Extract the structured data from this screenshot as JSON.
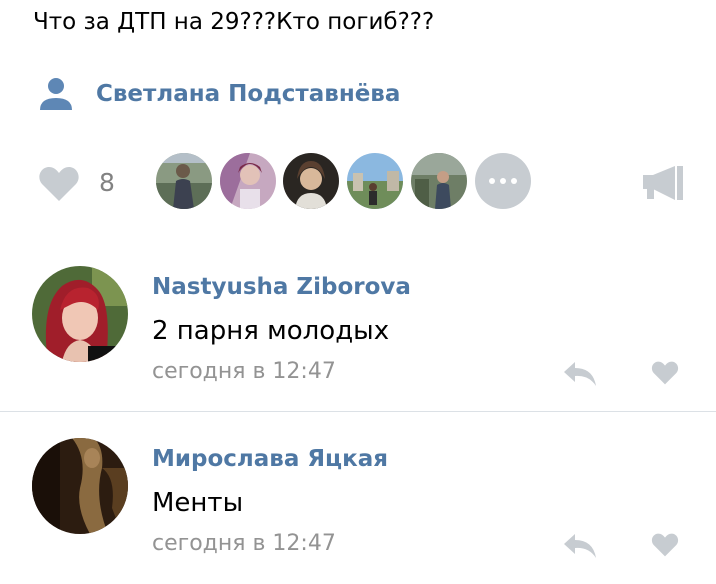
{
  "post": {
    "text": "Что за ДТП на 29???Кто погиб???",
    "author": "Светлана Подставнёва",
    "author_icon": "user-icon"
  },
  "likes": {
    "count": "8",
    "icon": "heart-icon",
    "share_icon": "megaphone-icon",
    "more_icon": "ellipsis-icon"
  },
  "comments": [
    {
      "author": "Nastyusha Ziborova",
      "text": "2 парня молодых",
      "time": "сегодня в 12:47",
      "reply_icon": "reply-icon",
      "like_icon": "heart-icon"
    },
    {
      "author": "Мирослава Яцкая",
      "text": "Менты",
      "time": "сегодня в 12:47",
      "reply_icon": "reply-icon",
      "like_icon": "heart-icon"
    }
  ],
  "colors": {
    "link": "#4f78a4",
    "icon_gray": "#c7ccd1",
    "meta_gray": "#939393",
    "divider": "#dce1e6"
  }
}
